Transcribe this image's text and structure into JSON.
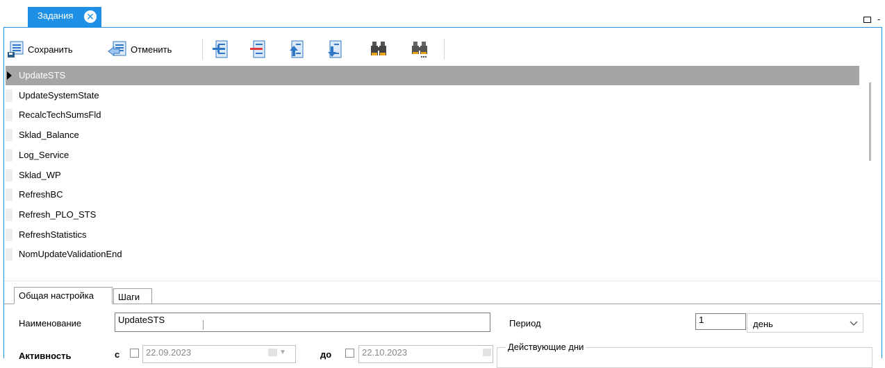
{
  "doc_tab": {
    "label": "Задания",
    "close_symbol": "✕"
  },
  "window_controls": {
    "restore_symbol": "",
    "minimize_symbol": "-"
  },
  "toolbar": {
    "save_label": "Сохранить",
    "cancel_label": "Отменить",
    "icons": [
      "save-icon",
      "cancel-icon",
      "add-row-icon",
      "delete-row-icon",
      "move-up-icon",
      "move-down-icon",
      "find-icon",
      "find-next-icon"
    ]
  },
  "tasks": {
    "selected_index": 0,
    "items": [
      "UpdateSTS",
      "UpdateSystemState",
      "RecalcTechSumsFld",
      "Sklad_Balance",
      "Log_Service",
      "Sklad_WP",
      "RefreshBC",
      "Refresh_PLO_STS",
      "RefreshStatistics",
      "NomUpdateValidationEnd"
    ]
  },
  "property_tabs": {
    "general": "Общая настройка",
    "steps": "Шаги",
    "active": "general"
  },
  "form": {
    "name_label": "Наименование",
    "name_value": "UpdateSTS",
    "period_label": "Период",
    "period_value": "1",
    "period_unit": "день",
    "activity_label": "Активность",
    "from_label": "с",
    "from_checked": false,
    "from_date": "22.09.2023",
    "to_label": "до",
    "to_checked": false,
    "to_date": "22.10.2023",
    "active_days_label": "Действующие дни"
  },
  "colors": {
    "accent": "#1e90e6",
    "selected_row": "#a5a5a5"
  }
}
